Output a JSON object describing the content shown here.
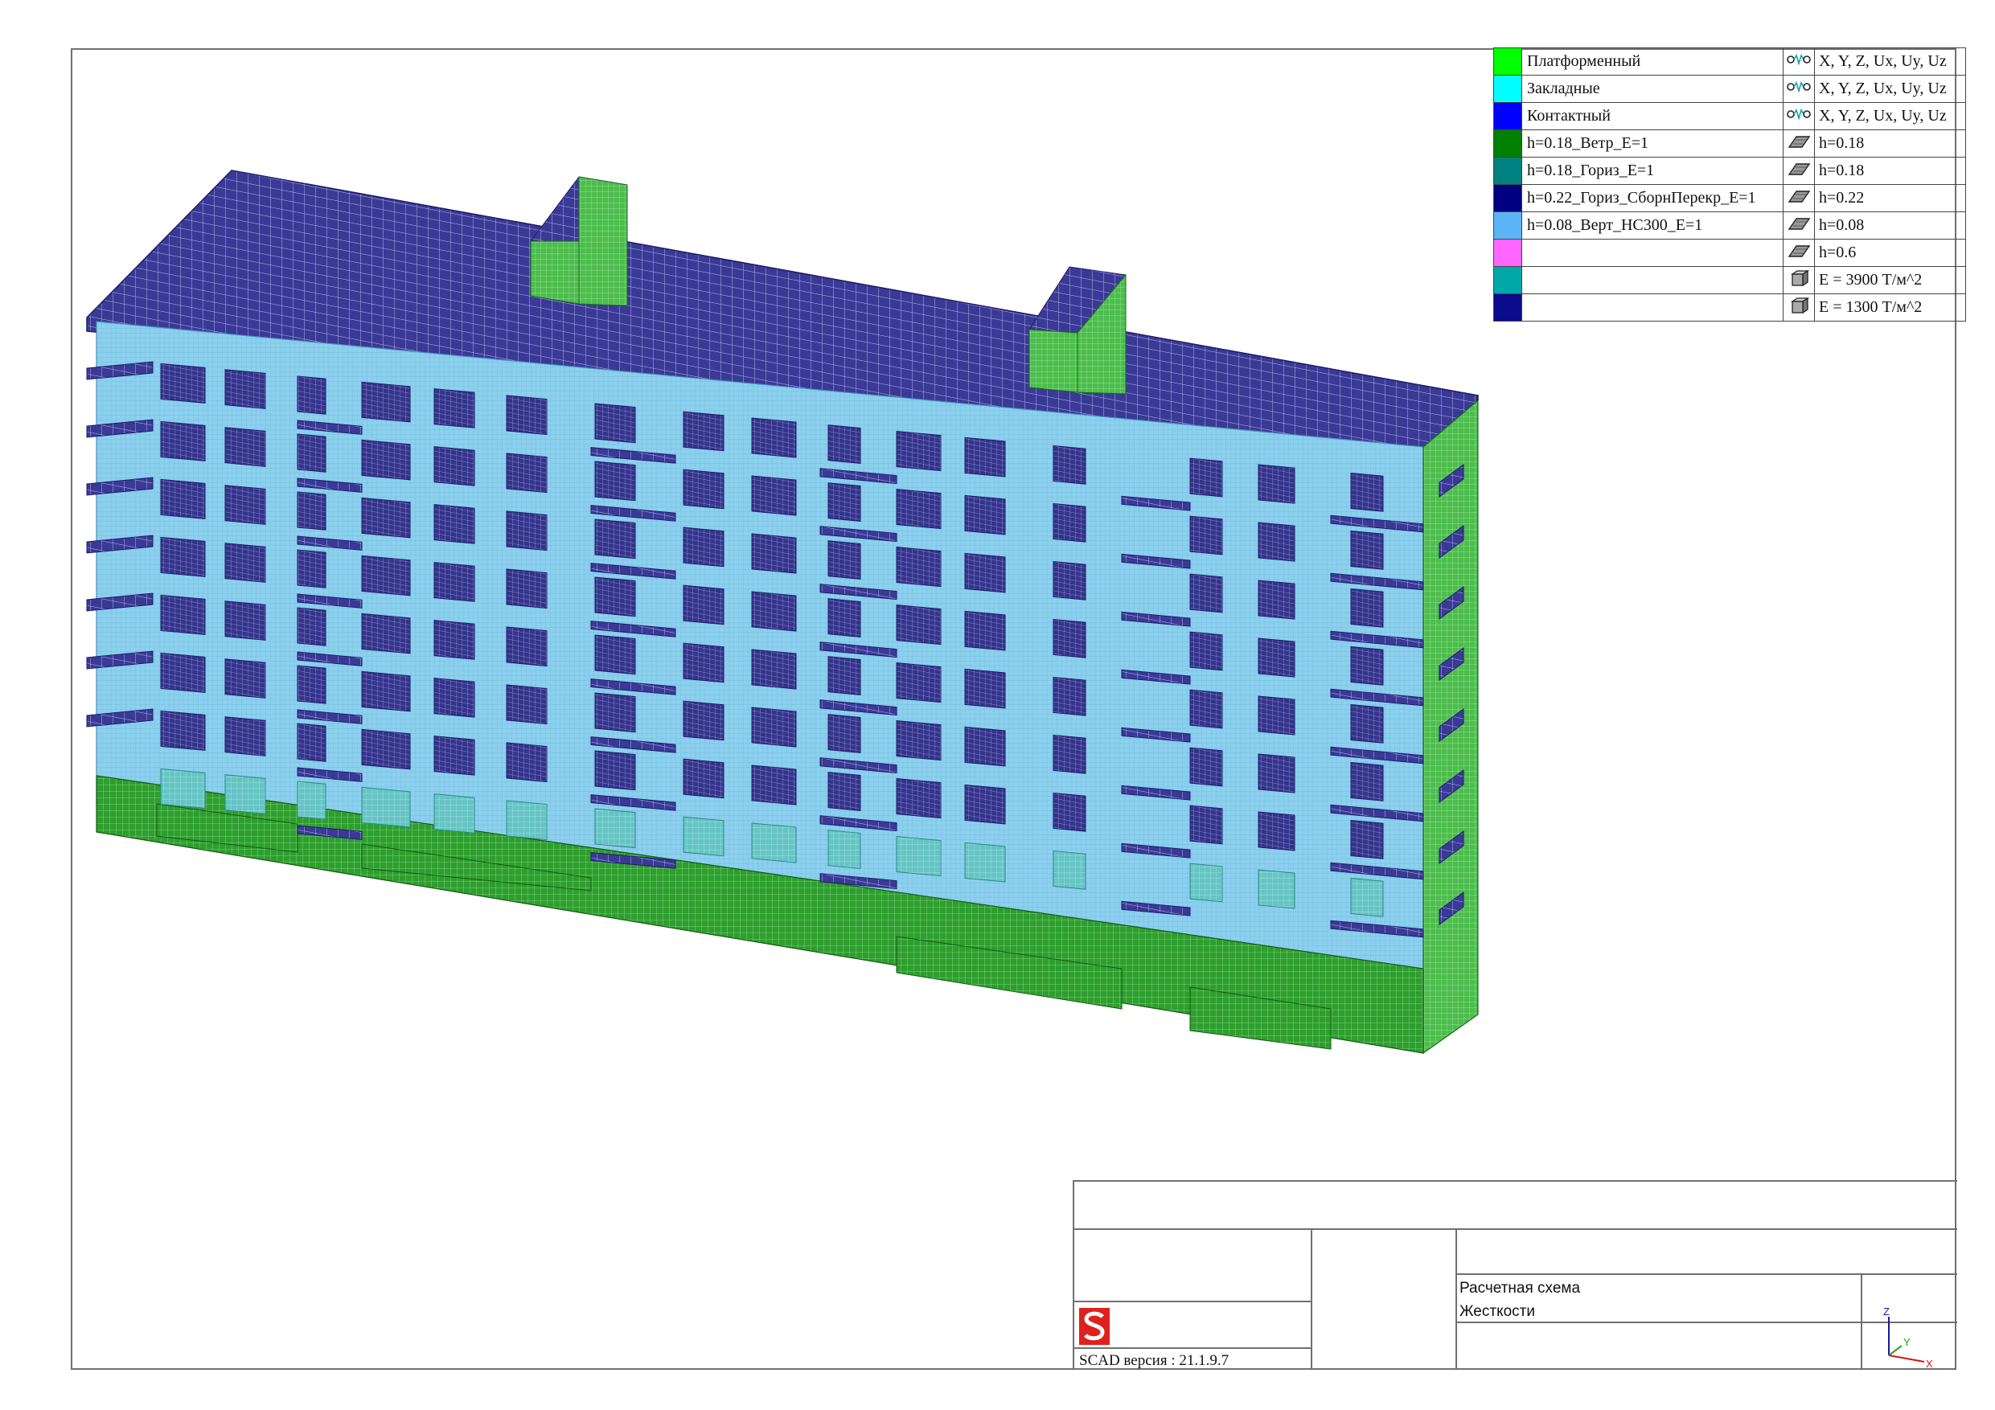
{
  "legend": {
    "rows": [
      {
        "swatch": "#00ff00",
        "name": "Платформенный",
        "icon": "spring-link-icon",
        "value": "X, Y, Z, Ux, Uy, Uz"
      },
      {
        "swatch": "#00ffff",
        "name": "Закладные",
        "icon": "spring-link-icon",
        "value": "X, Y, Z, Ux, Uy, Uz"
      },
      {
        "swatch": "#0000ff",
        "name": "Контактный",
        "icon": "spring-link-icon",
        "value": "X, Y, Z, Ux, Uy, Uz"
      },
      {
        "swatch": "#008000",
        "name": "h=0.18_Ветр_E=1",
        "icon": "plate-icon",
        "value": "h=0.18"
      },
      {
        "swatch": "#008080",
        "name": "h=0.18_Гориз_E=1",
        "icon": "plate-icon",
        "value": "h=0.18"
      },
      {
        "swatch": "#000080",
        "name": "h=0.22_Гориз_СборнПерекр_E=1",
        "icon": "plate-icon",
        "value": "h=0.22"
      },
      {
        "swatch": "#5ab4f5",
        "name": "h=0.08_Верт_НС300_E=1",
        "icon": "plate-icon",
        "value": "h=0.08"
      },
      {
        "swatch": "#ff66ff",
        "name": "",
        "icon": "plate-icon",
        "value": "h=0.6"
      },
      {
        "swatch": "#00a8a8",
        "name": "",
        "icon": "solid-icon",
        "value": "E = 3900 Т/м^2"
      },
      {
        "swatch": "#0a0a8c",
        "name": "",
        "icon": "solid-icon",
        "value": "E = 1300 Т/м^2"
      }
    ]
  },
  "title_block": {
    "caption_line1": "Расчетная схема",
    "caption_line2": "Жесткости",
    "version": "SCAD версия : 21.1.9.7",
    "axis_x": "X",
    "axis_y": "Y",
    "axis_z": "Z"
  },
  "colors": {
    "roof": "#3a3a96",
    "wall": "#8cd0ee",
    "base": "#2e9e2e",
    "side": "#4dbd4d",
    "window": "#34348a",
    "grid_light": "#ffffff",
    "logo": "#e0201e"
  }
}
